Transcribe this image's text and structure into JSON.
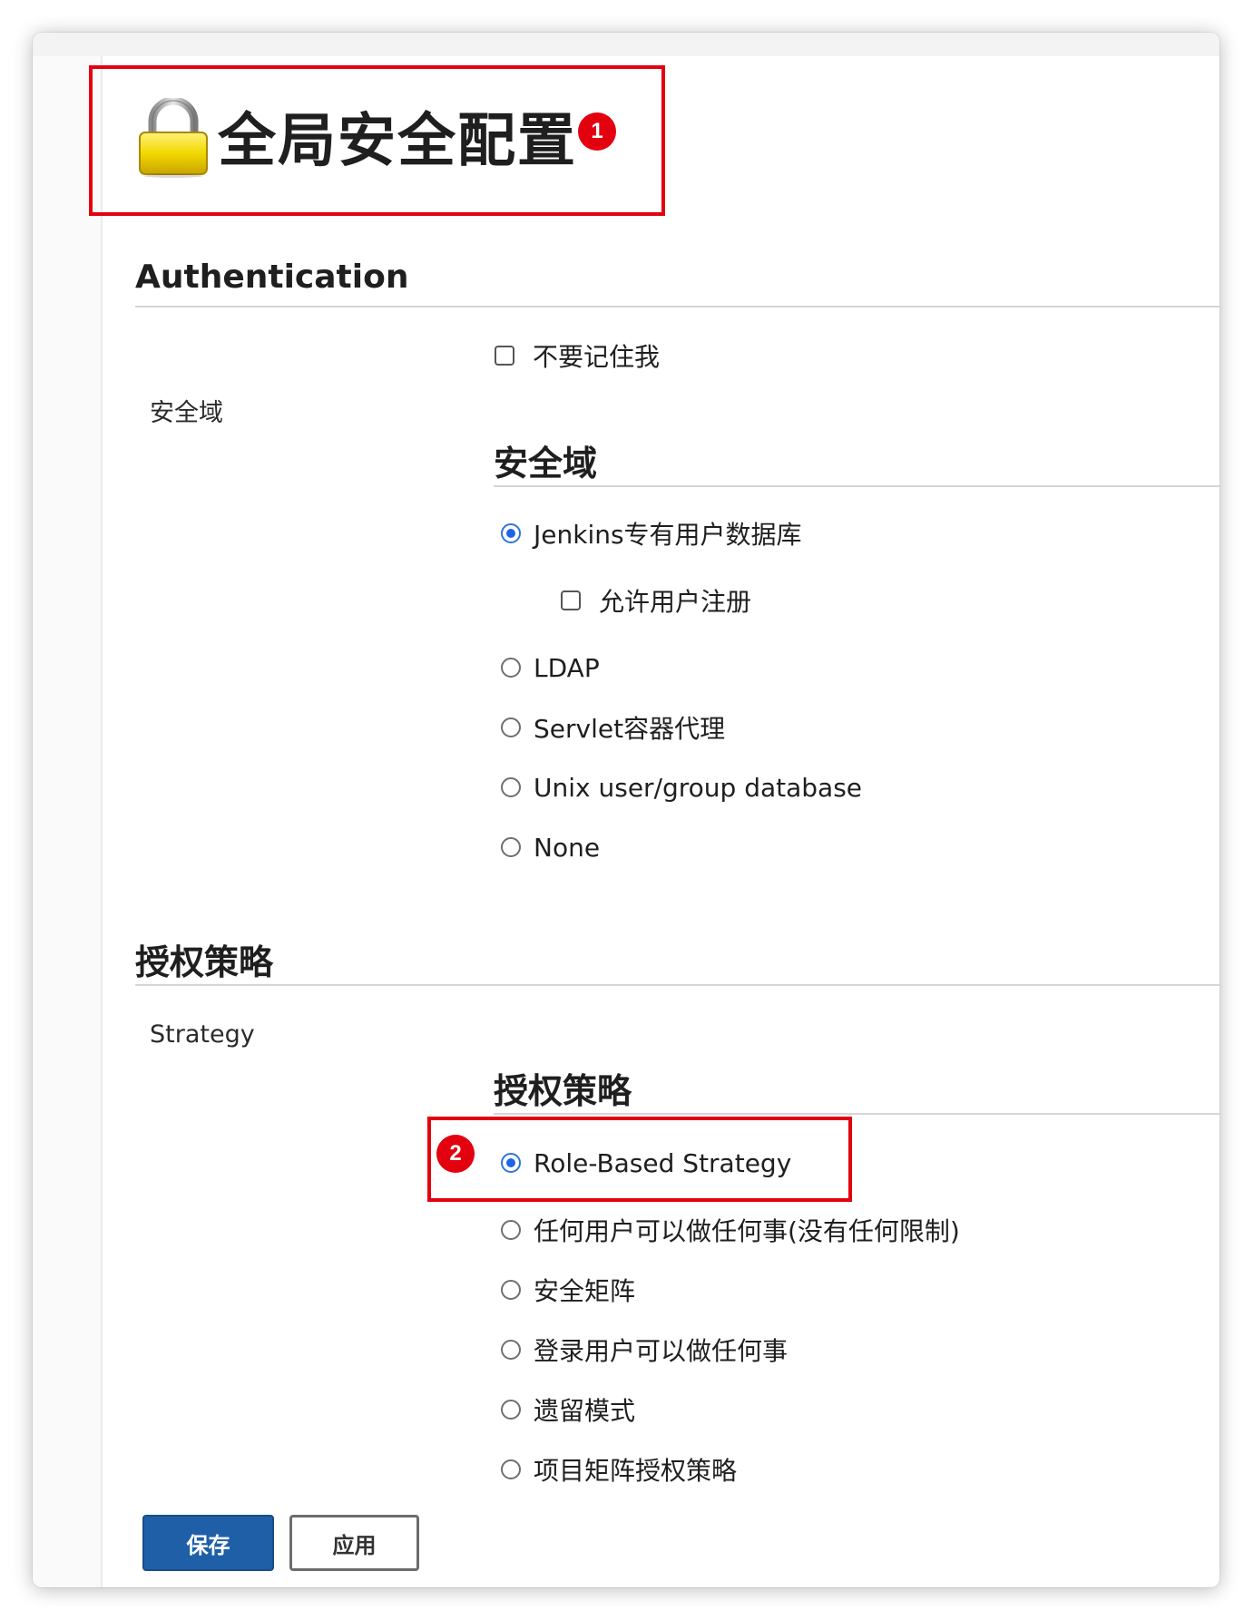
{
  "page": {
    "title": "全局安全配置",
    "lock_icon": "lock-icon",
    "annotations": [
      "1",
      "2"
    ],
    "accent_color": "#e3000f"
  },
  "authentication": {
    "heading": "Authentication",
    "remember_me_label": "不要记住我",
    "remember_me_checked": false,
    "security_realm_label": "安全域",
    "security_realm_heading": "安全域",
    "realm_options": [
      {
        "label": "Jenkins专有用户数据库",
        "selected": true
      },
      {
        "label": "允许用户注册",
        "checked": false
      },
      {
        "label": "LDAP",
        "selected": false
      },
      {
        "label": "Servlet容器代理",
        "selected": false
      },
      {
        "label": "Unix user/group database",
        "selected": false
      },
      {
        "label": "None",
        "selected": false
      }
    ]
  },
  "authorization": {
    "heading": "授权策略",
    "strategy_label": "Strategy",
    "strategy_heading": "授权策略",
    "options": [
      {
        "label": "Role-Based Strategy",
        "selected": true
      },
      {
        "label": "任何用户可以做任何事(没有任何限制)",
        "selected": false
      },
      {
        "label": "安全矩阵",
        "selected": false
      },
      {
        "label": "登录用户可以做任何事",
        "selected": false
      },
      {
        "label": "遗留模式",
        "selected": false
      },
      {
        "label": "项目矩阵授权策略",
        "selected": false
      }
    ]
  },
  "buttons": {
    "save": "保存",
    "apply": "应用",
    "primary_color": "#1e5fa7"
  }
}
